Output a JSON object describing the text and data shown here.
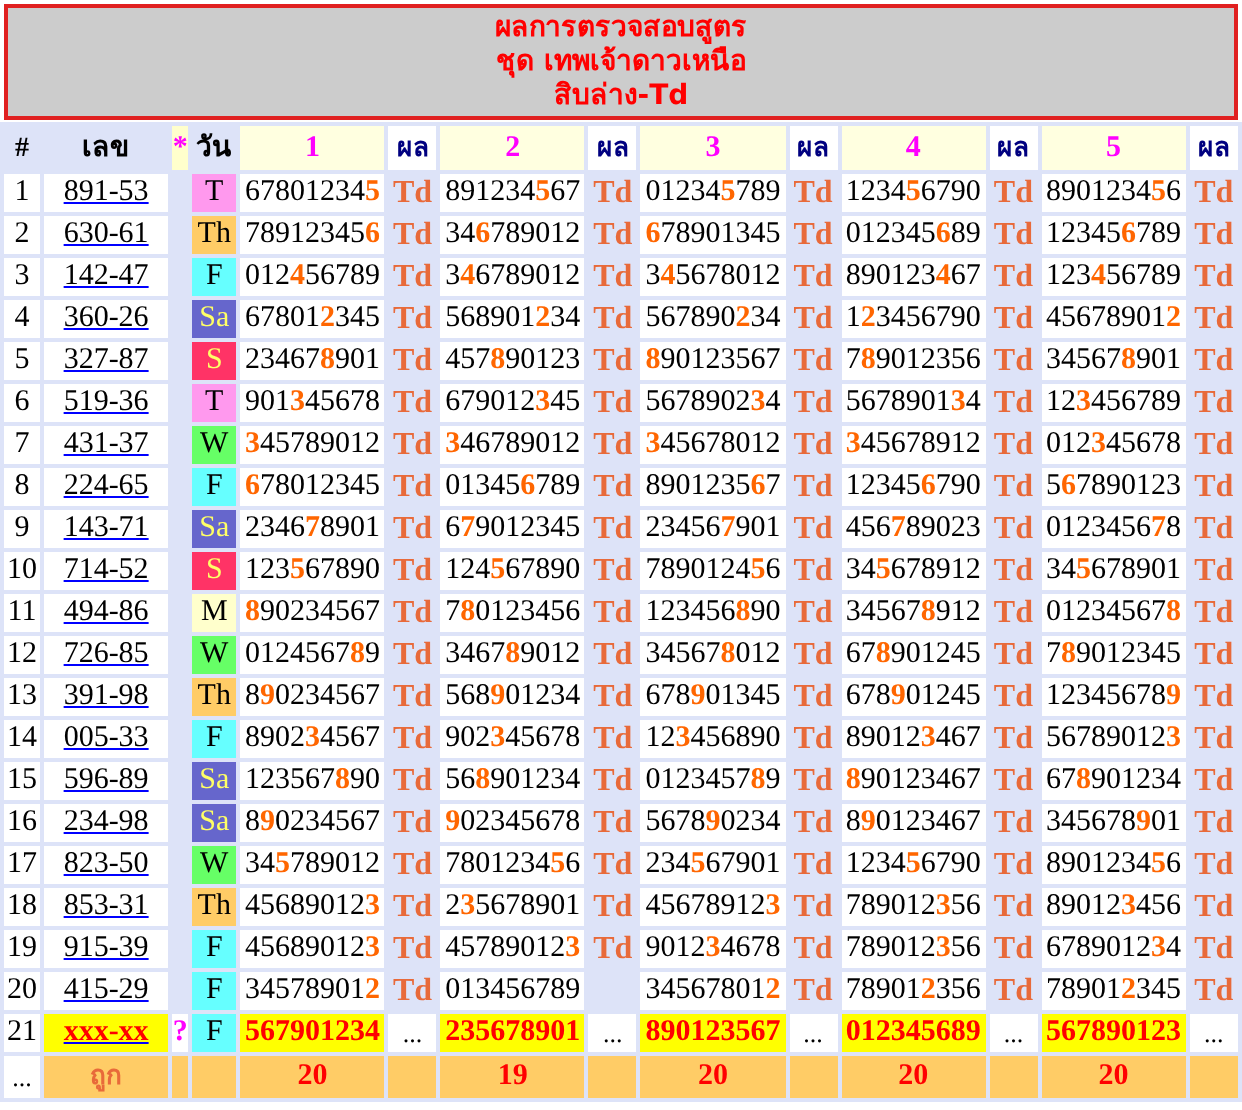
{
  "title": [
    "ผลการตรวจสอบสูตร",
    "ชุด เทพเจ้าดาวเหนือ",
    "สิบล่าง-Td"
  ],
  "columns": {
    "index": "#",
    "number": "เลข",
    "mark": "*",
    "day": "วัน",
    "sets": [
      {
        "label": "1",
        "result": "ผล"
      },
      {
        "label": "2",
        "result": "ผล"
      },
      {
        "label": "3",
        "result": "ผล"
      },
      {
        "label": "4",
        "result": "ผล"
      },
      {
        "label": "5",
        "result": "ผล"
      }
    ]
  },
  "rows": [
    {
      "kind": "checked",
      "index": "1",
      "number": "891-53",
      "day": {
        "label": "T",
        "color": "#ff99ee"
      },
      "cells": [
        {
          "digits": "67801234**5**",
          "result": "Td"
        },
        {
          "digits": "891234**5**67",
          "result": "Td"
        },
        {
          "digits": "01234**5**789",
          "result": "Td"
        },
        {
          "digits": "1234**5**6790",
          "result": "Td"
        },
        {
          "digits": "8901234**5**6",
          "result": "Td"
        }
      ]
    },
    {
      "kind": "checked",
      "index": "2",
      "number": "630-61",
      "day": {
        "label": "Th",
        "color": "#ffcc66"
      },
      "cells": [
        {
          "digits": "78912345**6**",
          "result": "Td"
        },
        {
          "digits": "34**6**789012",
          "result": "Td"
        },
        {
          "digits": "**6**78901345",
          "result": "Td"
        },
        {
          "digits": "012345**6**89",
          "result": "Td"
        },
        {
          "digits": "12345**6**789",
          "result": "Td"
        }
      ]
    },
    {
      "kind": "checked",
      "index": "3",
      "number": "142-47",
      "day": {
        "label": "F",
        "color": "#66ffff"
      },
      "cells": [
        {
          "digits": "012**4**56789",
          "result": "Td"
        },
        {
          "digits": "3**4**6789012",
          "result": "Td"
        },
        {
          "digits": "3**4**5678012",
          "result": "Td"
        },
        {
          "digits": "890123**4**67",
          "result": "Td"
        },
        {
          "digits": "123**4**56789",
          "result": "Td"
        }
      ]
    },
    {
      "kind": "checked",
      "index": "4",
      "number": "360-26",
      "day": {
        "label": "Sa",
        "color": "#6666cc"
      },
      "cells": [
        {
          "digits": "67801**2**345",
          "result": "Td"
        },
        {
          "digits": "568901**2**34",
          "result": "Td"
        },
        {
          "digits": "567890**2**34",
          "result": "Td"
        },
        {
          "digits": "1**2**3456790",
          "result": "Td"
        },
        {
          "digits": "45678901**2**",
          "result": "Td"
        }
      ]
    },
    {
      "kind": "checked",
      "index": "5",
      "number": "327-87",
      "day": {
        "label": "S",
        "color": "#ff3366"
      },
      "cells": [
        {
          "digits": "23467**8**901",
          "result": "Td"
        },
        {
          "digits": "457**8**90123",
          "result": "Td"
        },
        {
          "digits": "**8**90123567",
          "result": "Td"
        },
        {
          "digits": "7**8**9012356",
          "result": "Td"
        },
        {
          "digits": "34567**8**901",
          "result": "Td"
        }
      ]
    },
    {
      "kind": "checked",
      "index": "6",
      "number": "519-36",
      "day": {
        "label": "T",
        "color": "#ff99ee"
      },
      "cells": [
        {
          "digits": "901**3**45678",
          "result": "Td"
        },
        {
          "digits": "679012**3**45",
          "result": "Td"
        },
        {
          "digits": "5678902**3**4",
          "result": "Td"
        },
        {
          "digits": "5678901**3**4",
          "result": "Td"
        },
        {
          "digits": "12**3**456789",
          "result": "Td"
        }
      ]
    },
    {
      "kind": "checked",
      "index": "7",
      "number": "431-37",
      "day": {
        "label": "W",
        "color": "#66ff66"
      },
      "cells": [
        {
          "digits": "**3**45789012",
          "result": "Td"
        },
        {
          "digits": "**3**46789012",
          "result": "Td"
        },
        {
          "digits": "**3**45678012",
          "result": "Td"
        },
        {
          "digits": "**3**45678912",
          "result": "Td"
        },
        {
          "digits": "012**3**45678",
          "result": "Td"
        }
      ]
    },
    {
      "kind": "checked",
      "index": "8",
      "number": "224-65",
      "day": {
        "label": "F",
        "color": "#66ffff"
      },
      "cells": [
        {
          "digits": "**6**78012345",
          "result": "Td"
        },
        {
          "digits": "01345**6**789",
          "result": "Td"
        },
        {
          "digits": "8901235**6**7",
          "result": "Td"
        },
        {
          "digits": "12345**6**790",
          "result": "Td"
        },
        {
          "digits": "5**6**7890123",
          "result": "Td"
        }
      ]
    },
    {
      "kind": "checked",
      "index": "9",
      "number": "143-71",
      "day": {
        "label": "Sa",
        "color": "#6666cc"
      },
      "cells": [
        {
          "digits": "2346**7**8901",
          "result": "Td"
        },
        {
          "digits": "6**7**9012345",
          "result": "Td"
        },
        {
          "digits": "23456**7**901",
          "result": "Td"
        },
        {
          "digits": "456**7**89023",
          "result": "Td"
        },
        {
          "digits": "0123456**7**8",
          "result": "Td"
        }
      ]
    },
    {
      "kind": "checked",
      "index": "10",
      "number": "714-52",
      "day": {
        "label": "S",
        "color": "#ff3366"
      },
      "cells": [
        {
          "digits": "123**5**67890",
          "result": "Td"
        },
        {
          "digits": "124**5**67890",
          "result": "Td"
        },
        {
          "digits": "7890124**5**6",
          "result": "Td"
        },
        {
          "digits": "34**5**678912",
          "result": "Td"
        },
        {
          "digits": "34**5**678901",
          "result": "Td"
        }
      ]
    },
    {
      "kind": "checked",
      "index": "11",
      "number": "494-86",
      "day": {
        "label": "M",
        "color": "#ffffcc"
      },
      "cells": [
        {
          "digits": "**8**90234567",
          "result": "Td"
        },
        {
          "digits": "7**8**0123456",
          "result": "Td"
        },
        {
          "digits": "123456**8**90",
          "result": "Td"
        },
        {
          "digits": "34567**8**912",
          "result": "Td"
        },
        {
          "digits": "01234567**8**",
          "result": "Td"
        }
      ]
    },
    {
      "kind": "checked",
      "index": "12",
      "number": "726-85",
      "day": {
        "label": "W",
        "color": "#66ff66"
      },
      "cells": [
        {
          "digits": "0124567**8**9",
          "result": "Td"
        },
        {
          "digits": "3467**8**9012",
          "result": "Td"
        },
        {
          "digits": "34567**8**012",
          "result": "Td"
        },
        {
          "digits": "67**8**901245",
          "result": "Td"
        },
        {
          "digits": "7**8**9012345",
          "result": "Td"
        }
      ]
    },
    {
      "kind": "checked",
      "index": "13",
      "number": "391-98",
      "day": {
        "label": "Th",
        "color": "#ffcc66"
      },
      "cells": [
        {
          "digits": "8**9**0234567",
          "result": "Td"
        },
        {
          "digits": "568**9**01234",
          "result": "Td"
        },
        {
          "digits": "678**9**01345",
          "result": "Td"
        },
        {
          "digits": "678**9**01245",
          "result": "Td"
        },
        {
          "digits": "12345678**9**",
          "result": "Td"
        }
      ]
    },
    {
      "kind": "checked",
      "index": "14",
      "number": "005-33",
      "day": {
        "label": "F",
        "color": "#66ffff"
      },
      "cells": [
        {
          "digits": "8902**3**4567",
          "result": "Td"
        },
        {
          "digits": "902**3**45678",
          "result": "Td"
        },
        {
          "digits": "12**3**456890",
          "result": "Td"
        },
        {
          "digits": "89012**3**467",
          "result": "Td"
        },
        {
          "digits": "56789012**3**",
          "result": "Td"
        }
      ]
    },
    {
      "kind": "checked",
      "index": "15",
      "number": "596-89",
      "day": {
        "label": "Sa",
        "color": "#6666cc"
      },
      "cells": [
        {
          "digits": "123567**8**90",
          "result": "Td"
        },
        {
          "digits": "56**8**901234",
          "result": "Td"
        },
        {
          "digits": "0123457**8**9",
          "result": "Td"
        },
        {
          "digits": "**8**90123467",
          "result": "Td"
        },
        {
          "digits": "67**8**901234",
          "result": "Td"
        }
      ]
    },
    {
      "kind": "checked",
      "index": "16",
      "number": "234-98",
      "day": {
        "label": "Sa",
        "color": "#6666cc"
      },
      "cells": [
        {
          "digits": "8**9**0234567",
          "result": "Td"
        },
        {
          "digits": "**9**02345678",
          "result": "Td"
        },
        {
          "digits": "5678**9**0234",
          "result": "Td"
        },
        {
          "digits": "8**9**0123467",
          "result": "Td"
        },
        {
          "digits": "345678**9**01",
          "result": "Td"
        }
      ]
    },
    {
      "kind": "checked",
      "index": "17",
      "number": "823-50",
      "day": {
        "label": "W",
        "color": "#66ff66"
      },
      "cells": [
        {
          "digits": "34**5**789012",
          "result": "Td"
        },
        {
          "digits": "7801234**5**6",
          "result": "Td"
        },
        {
          "digits": "234**5**67901",
          "result": "Td"
        },
        {
          "digits": "1234**5**6790",
          "result": "Td"
        },
        {
          "digits": "8901234**5**6",
          "result": "Td"
        }
      ]
    },
    {
      "kind": "checked",
      "index": "18",
      "number": "853-31",
      "day": {
        "label": "Th",
        "color": "#ffcc66"
      },
      "cells": [
        {
          "digits": "45689012**3**",
          "result": "Td"
        },
        {
          "digits": "2**3**5678901",
          "result": "Td"
        },
        {
          "digits": "45678912**3**",
          "result": "Td"
        },
        {
          "digits": "789012**3**56",
          "result": "Td"
        },
        {
          "digits": "89012**3**456",
          "result": "Td"
        }
      ]
    },
    {
      "kind": "checked",
      "index": "19",
      "number": "915-39",
      "day": {
        "label": "F",
        "color": "#66ffff"
      },
      "cells": [
        {
          "digits": "45689012**3**",
          "result": "Td"
        },
        {
          "digits": "45789012**3**",
          "result": "Td"
        },
        {
          "digits": "9012**3**4678",
          "result": "Td"
        },
        {
          "digits": "789012**3**56",
          "result": "Td"
        },
        {
          "digits": "6789012**3**4",
          "result": "Td"
        }
      ]
    },
    {
      "kind": "checked",
      "index": "20",
      "number": "415-29",
      "day": {
        "label": "F",
        "color": "#66ffff"
      },
      "cells": [
        {
          "digits": "34578901**2**",
          "result": "Td"
        },
        {
          "digits": "013456789"
        },
        {
          "digits": "34567801**2**",
          "result": "Td"
        },
        {
          "digits": "78901**2**356",
          "result": "Td"
        },
        {
          "digits": "78901**2**345",
          "result": "Td"
        }
      ]
    },
    {
      "kind": "pending",
      "index": "21",
      "number": "xxx-xx",
      "mark": "?",
      "day": {
        "label": "F",
        "color": "#66ffff"
      },
      "cells": [
        {
          "digits": "567901234",
          "result": "..."
        },
        {
          "digits": "235678901",
          "result": "..."
        },
        {
          "digits": "890123567",
          "result": "..."
        },
        {
          "digits": "012345689",
          "result": "..."
        },
        {
          "digits": "567890123",
          "result": "..."
        }
      ]
    }
  ],
  "footer": {
    "index": "...",
    "label": "ถูก",
    "counts": [
      "20",
      "19",
      "20",
      "20",
      "20"
    ]
  }
}
